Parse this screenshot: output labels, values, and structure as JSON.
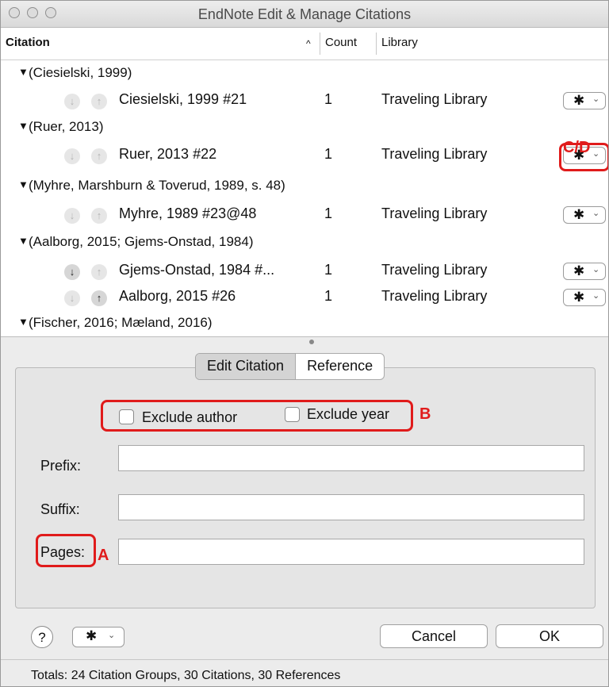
{
  "window": {
    "title": "EndNote Edit & Manage Citations"
  },
  "list_header": {
    "citation": "Citation",
    "sort_indicator": "^",
    "count": "Count",
    "library": "Library"
  },
  "groups": [
    {
      "label": "(Ciesielski, 1999)"
    },
    {
      "label": "(Ruer, 2013)"
    },
    {
      "label": "(Myhre, Marshburn & Toverud, 1989, s. 48)"
    },
    {
      "label": "(Aalborg, 2015; Gjems-Onstad, 1984)"
    },
    {
      "label": "(Fischer, 2016; Mæland, 2016)"
    }
  ],
  "citations": [
    {
      "name": "Ciesielski, 1999 #21",
      "count": "1",
      "library": "Traveling Library"
    },
    {
      "name": "Ruer, 2013 #22",
      "count": "1",
      "library": "Traveling Library"
    },
    {
      "name": "Myhre, 1989 #23@48",
      "count": "1",
      "library": "Traveling Library"
    },
    {
      "name": "Gjems-Onstad, 1984 #...",
      "count": "1",
      "library": "Traveling Library"
    },
    {
      "name": "Aalborg, 2015 #26",
      "count": "1",
      "library": "Traveling Library"
    }
  ],
  "icons": {
    "down_arrow": "↓",
    "up_arrow": "↑",
    "gear": "✱",
    "chevron": "⌄",
    "triangle": "▼",
    "help": "?"
  },
  "tabs": {
    "edit_citation": "Edit Citation",
    "reference": "Reference"
  },
  "options": {
    "exclude_author": "Exclude author",
    "exclude_year": "Exclude year"
  },
  "fields": {
    "prefix": {
      "label": "Prefix:",
      "value": ""
    },
    "suffix": {
      "label": "Suffix:",
      "value": ""
    },
    "pages": {
      "label": "Pages:",
      "value": ""
    }
  },
  "annotations": {
    "a": "A",
    "b": "B",
    "cd": "C/D"
  },
  "buttons": {
    "cancel": "Cancel",
    "ok": "OK"
  },
  "status": {
    "totals": "Totals: 24 Citation Groups, 30 Citations, 30 References"
  },
  "colors": {
    "annotation": "#e01b1b"
  }
}
